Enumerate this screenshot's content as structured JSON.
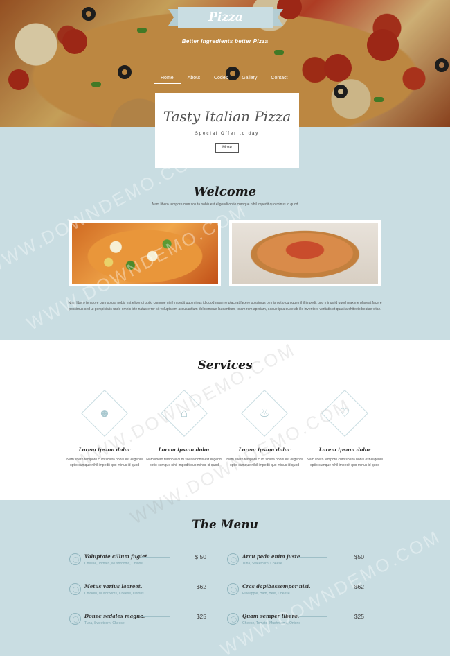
{
  "header": {
    "brand": "Pizza",
    "tagline": "Better Ingredients better Pizza",
    "nav": [
      "Home",
      "About",
      "Codes",
      "Gallery",
      "Contact"
    ],
    "active_nav": "Home"
  },
  "banner": {
    "title": "Tasty Italian Pizza",
    "subtitle": "Special Offer to day",
    "button": "More"
  },
  "welcome": {
    "title": "Welcome",
    "subtitle": "Nam libero tempore cum soluta nobis est eligendi optio cumque nihil impedit quo minus id quod",
    "paragraph": "Nam libero tempore cum soluta nobis est eligendi optio cumque nihil impedit quo minus id quod maxime placeat facere possimus omnis optio cumque nihil impedit quo minus id quod maxime placeat facere possimus sed ut perspiciatis unde omnis iste natus error sit voluptatem accusantium doloremque laudantium, totam rem aperiam, eaque ipsa quae ab illo inventore veritatis et quasi architecto beatae vitae."
  },
  "services": {
    "title": "Services",
    "items": [
      {
        "icon": "user-icon",
        "title": "Lorem ipsum dolor",
        "text": "Nam libero tempore cum soluta nobis est eligendi optio cumque nihil impedit quo minus id quod"
      },
      {
        "icon": "home-icon",
        "title": "Lorem ipsum dolor",
        "text": "Nam libero tempore cum soluta nobis est eligendi optio cumque nihil impedit quo minus id quod"
      },
      {
        "icon": "fire-icon",
        "title": "Lorem ipsum dolor",
        "text": "Nam libero tempore cum soluta nobis est eligendi optio cumque nihil impedit quo minus id quod"
      },
      {
        "icon": "heart-icon",
        "title": "Lorem ipsum dolor",
        "text": "Nam libero tempore cum soluta nobis est eligendi optio cumque nihil impedit quo minus id quod"
      }
    ]
  },
  "menu": {
    "title": "The Menu",
    "items": [
      {
        "name": "Voluptate cillum fugiat.",
        "ingredients": "Cheese, Tomato, Mushrooms, Onions",
        "price": "$ 50"
      },
      {
        "name": "Arcu pede enim juste.",
        "ingredients": "Tuna, Sweetcorn, Cheese",
        "price": "$50"
      },
      {
        "name": "Metus varius laoreet.",
        "ingredients": "Chicken, Mushrooms, Cheese, Onions",
        "price": "$62"
      },
      {
        "name": "Cras dapibassemper nisi.",
        "ingredients": "Pineapple, Ham, Beef, Cheese",
        "price": "$62"
      },
      {
        "name": "Donec sedales magna.",
        "ingredients": "Tuna, Sweetcorn, Cheese",
        "price": "$25"
      },
      {
        "name": "Quam semper libero.",
        "ingredients": "Cheese, Tomato, Mushrooms, Onions",
        "price": "$25"
      }
    ]
  },
  "watermark": "WWW.DOWNDEMO.COM",
  "colors": {
    "accent": "#c9dde2",
    "icon": "#a9c8cf"
  }
}
